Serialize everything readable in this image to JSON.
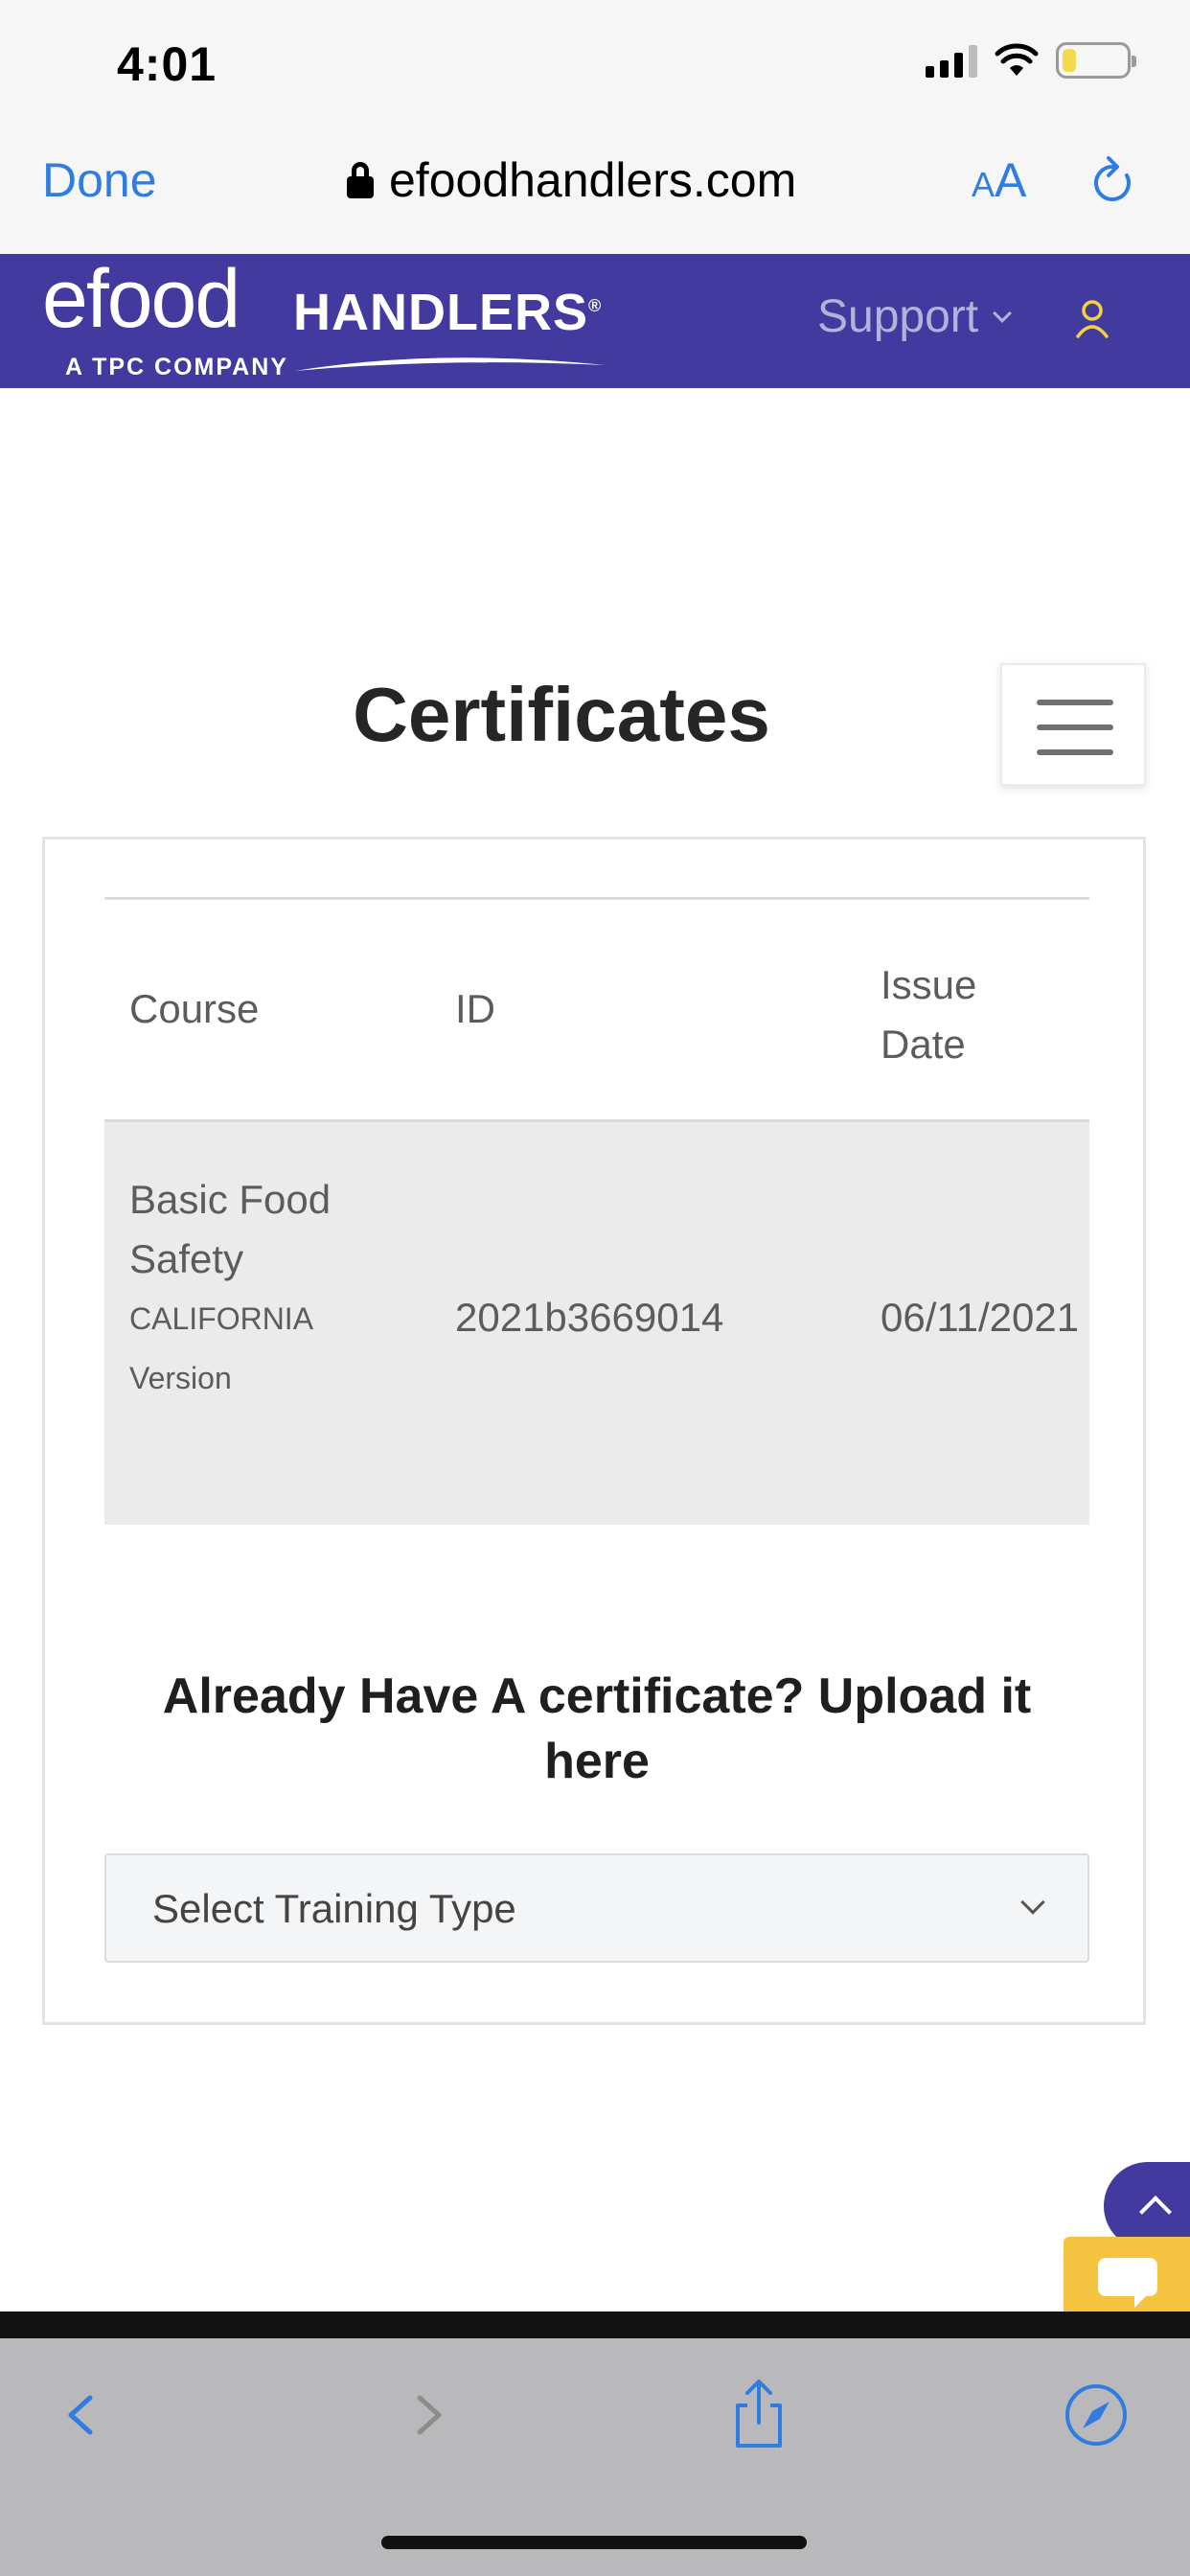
{
  "status_bar": {
    "time": "4:01"
  },
  "browser": {
    "done_label": "Done",
    "url": "efoodhandlers.com",
    "text_size_small": "A",
    "text_size_big": "A"
  },
  "site_header": {
    "logo_text_efood": "efood",
    "logo_text_handlers": "HANDLERS",
    "logo_registered": "®",
    "logo_tagline": "A TPC COMPANY",
    "support_label": "Support",
    "brand_color": "#423a9f"
  },
  "page": {
    "title": "Certificates"
  },
  "certificates_table": {
    "headers": {
      "course": "Course",
      "id": "ID",
      "issue_date": "Issue Date"
    },
    "rows": [
      {
        "course_name": "Basic Food Safety",
        "course_version": "CALIFORNIA Version",
        "id": "2021b3669014",
        "issue_date": "06/11/2021"
      }
    ]
  },
  "upload": {
    "heading": "Already Have A certificate? Upload it here",
    "select_value": "Select Training Type"
  },
  "icons": {
    "lock": "lock-icon",
    "reload": "reload-icon",
    "user": "user-icon",
    "menu": "hamburger-menu-icon",
    "scroll_top": "chevron-up-icon",
    "chat": "chat-bubble-icon",
    "back": "back-arrow-icon",
    "forward": "forward-arrow-icon",
    "share": "share-icon",
    "compass": "compass-icon"
  }
}
